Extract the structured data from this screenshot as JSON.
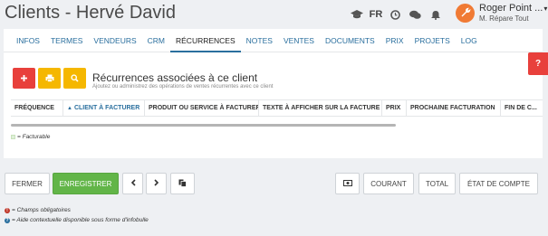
{
  "header": {
    "title": "Clients - Hervé David",
    "language": "FR",
    "user_name": "Roger Point ...",
    "user_company": "M. Répare Tout",
    "colors": {
      "avatar": "#f07a34"
    }
  },
  "tabs": [
    {
      "label": "INFOS",
      "active": false
    },
    {
      "label": "TERMES",
      "active": false
    },
    {
      "label": "VENDEURS",
      "active": false
    },
    {
      "label": "CRM",
      "active": false
    },
    {
      "label": "RÉCURRENCES",
      "active": true
    },
    {
      "label": "NOTES",
      "active": false
    },
    {
      "label": "VENTES",
      "active": false
    },
    {
      "label": "DOCUMENTS",
      "active": false
    },
    {
      "label": "PRIX",
      "active": false
    },
    {
      "label": "PROJETS",
      "active": false
    },
    {
      "label": "LOG",
      "active": false
    }
  ],
  "section": {
    "title": "Récurrences associées à ce client",
    "subtitle": "Ajoutez ou administrez des opérations de ventes récurrentes avec ce client",
    "buttons": {
      "add_icon": "plus-icon",
      "print_icon": "print-icon",
      "search_icon": "search-icon"
    }
  },
  "table": {
    "columns": [
      "FRÉQUENCE",
      "CLIENT À FACTURER",
      "PRODUIT OU SERVICE À FACTURER",
      "TEXTE À AFFICHER SUR LA FACTURE",
      "PRIX",
      "PROCHAINE FACTURATION",
      "FIN DE C..."
    ],
    "sorted_column": "CLIENT À FACTURER",
    "rows": []
  },
  "legend": {
    "billable": "= Facturable"
  },
  "help_tab": "?",
  "footer": {
    "close": "FERMER",
    "save": "ENREGISTRER",
    "current": "COURANT",
    "total": "TOTAL",
    "statement": "ÉTAT DE COMPTE"
  },
  "notes": {
    "required": "= Champs obligatoires",
    "help": "= Aide contextuelle disponible sous forme d'infobulle"
  }
}
